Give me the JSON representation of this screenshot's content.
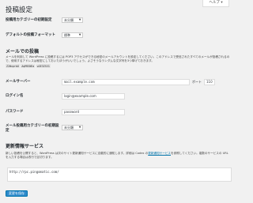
{
  "help_tab": "ヘルプ ▾",
  "page_title": "投稿設定",
  "default_category": {
    "label": "投稿用カテゴリーの初期設定",
    "value": "未分類"
  },
  "default_format": {
    "label": "デフォルトの投稿フォーマット",
    "value": "標準"
  },
  "post_via_email": {
    "heading": "メールでの投稿",
    "description": "メールを利用して WordPress に投稿するには POP3 アクセスができる秘密のメールアカウントを設定してください。このアドレスで受信されたすべてのメールが投稿されるので、使用するアドレスは秘密にしておいたほうがいいでしょう。よさそうなランダムな文字列を3つ挙げておきます。",
    "codes": [
      "Z2WxprbU",
      "AqM9SNEa",
      "wGE3ZSCG"
    ],
    "server_label": "メールサーバー",
    "server_value": "mail.example.com",
    "port_label": "ポート",
    "port_value": "110",
    "login_label": "ログイン名",
    "login_value": "login@example.com",
    "password_label": "パスワード",
    "password_value": "password",
    "category_label": "メール投稿用カテゴリーの初期設定",
    "category_value": "未分類"
  },
  "update_services": {
    "heading": "更新情報サービス",
    "description_pre": "新しい投稿を公開すると、WordPress は次のサイト更新通知サービスに自動的に通知します。詳細は Codex の",
    "description_link": "更新通知サービス",
    "description_post": "を参照してください。複数のサービスの URL を入力する場合は改行で区切ります。",
    "services_value": "http://rpc.pingomatic.com/"
  },
  "save_button": "変更を保存"
}
